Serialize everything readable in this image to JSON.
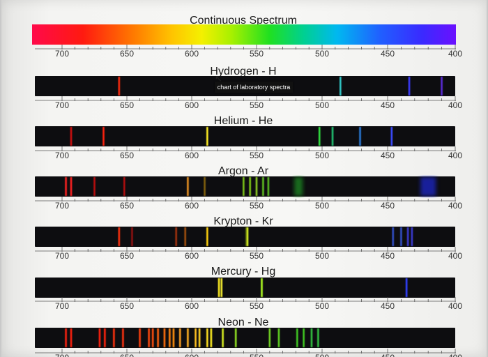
{
  "chart_data": {
    "type": "spectrum",
    "axis": {
      "ticks": [
        700,
        650,
        600,
        550,
        500,
        450,
        400
      ],
      "range": [
        705,
        395
      ]
    },
    "panels": [
      {
        "title": "Continuous Spectrum",
        "kind": "continuous",
        "lines": []
      },
      {
        "title": "Hydrogen - H",
        "kind": "emission",
        "lines": [
          {
            "nm": 656,
            "color": "#ff2a10"
          },
          {
            "nm": 486,
            "color": "#33c8c8"
          },
          {
            "nm": 434,
            "color": "#3a3aff"
          },
          {
            "nm": 410,
            "color": "#5a2ad8"
          }
        ]
      },
      {
        "title": "Helium - He",
        "kind": "emission",
        "lines": [
          {
            "nm": 707,
            "color": "#d01010"
          },
          {
            "nm": 668,
            "color": "#ff2410"
          },
          {
            "nm": 588,
            "color": "#ffee22"
          },
          {
            "nm": 502,
            "color": "#30e040"
          },
          {
            "nm": 492,
            "color": "#20c070"
          },
          {
            "nm": 471,
            "color": "#2a7ad8"
          },
          {
            "nm": 447,
            "color": "#3a4cff"
          }
        ]
      },
      {
        "title": "Argon - Ar",
        "kind": "emission",
        "lines": [
          {
            "nm": 707,
            "color": "#ff2020"
          },
          {
            "nm": 697,
            "color": "#ff2020"
          },
          {
            "nm": 675,
            "color": "#b81010"
          },
          {
            "nm": 652,
            "color": "#b01010"
          },
          {
            "nm": 603,
            "color": "#e89020"
          },
          {
            "nm": 590,
            "color": "#806010"
          },
          {
            "nm": 560,
            "color": "#7ac018"
          },
          {
            "nm": 555,
            "color": "#80c818"
          },
          {
            "nm": 550,
            "color": "#8ac820"
          },
          {
            "nm": 545,
            "color": "#60c020"
          },
          {
            "nm": 541,
            "color": "#58b820"
          },
          {
            "nm": 518,
            "color": "#1a8a20",
            "wide": 12
          },
          {
            "nm": 420,
            "color": "#1a28c8",
            "wide": 22
          }
        ]
      },
      {
        "title": "Krypton - Kr",
        "kind": "emission",
        "lines": [
          {
            "nm": 656,
            "color": "#ff3010"
          },
          {
            "nm": 646,
            "color": "#901010"
          },
          {
            "nm": 612,
            "color": "#a03010"
          },
          {
            "nm": 605,
            "color": "#a05010"
          },
          {
            "nm": 588,
            "color": "#ffd010"
          },
          {
            "nm": 558,
            "color": "#506010"
          },
          {
            "nm": 557,
            "color": "#d8f020"
          },
          {
            "nm": 446,
            "color": "#3050c8"
          },
          {
            "nm": 440,
            "color": "#3050c8"
          },
          {
            "nm": 435,
            "color": "#3a3ad0"
          },
          {
            "nm": 432,
            "color": "#3a3ad0"
          }
        ]
      },
      {
        "title": "Mercury - Hg",
        "kind": "emission",
        "lines": [
          {
            "nm": 579,
            "color": "#ffee20"
          },
          {
            "nm": 577,
            "color": "#f0e830"
          },
          {
            "nm": 546,
            "color": "#b0ff20"
          },
          {
            "nm": 436,
            "color": "#3040ff"
          }
        ]
      },
      {
        "title": "Neon - Ne",
        "kind": "emission",
        "lines": [
          {
            "nm": 703,
            "color": "#ff2010"
          },
          {
            "nm": 693,
            "color": "#ff2010"
          },
          {
            "nm": 671,
            "color": "#ff2410"
          },
          {
            "nm": 667,
            "color": "#ff2410"
          },
          {
            "nm": 660,
            "color": "#ff3010"
          },
          {
            "nm": 653,
            "color": "#ff3010"
          },
          {
            "nm": 640,
            "color": "#ff4010"
          },
          {
            "nm": 633,
            "color": "#ff4a10"
          },
          {
            "nm": 630,
            "color": "#ff5010"
          },
          {
            "nm": 626,
            "color": "#ff6010"
          },
          {
            "nm": 621,
            "color": "#ff7010"
          },
          {
            "nm": 617,
            "color": "#ff8010"
          },
          {
            "nm": 614,
            "color": "#ff9010"
          },
          {
            "nm": 609,
            "color": "#ffa020"
          },
          {
            "nm": 603,
            "color": "#ffb020"
          },
          {
            "nm": 597,
            "color": "#ffc020"
          },
          {
            "nm": 594,
            "color": "#ffd020"
          },
          {
            "nm": 588,
            "color": "#ffe020"
          },
          {
            "nm": 585,
            "color": "#ffee20"
          },
          {
            "nm": 576,
            "color": "#d8f020"
          },
          {
            "nm": 566,
            "color": "#90e020"
          },
          {
            "nm": 540,
            "color": "#70d020"
          },
          {
            "nm": 533,
            "color": "#60d020"
          },
          {
            "nm": 519,
            "color": "#40c820"
          },
          {
            "nm": 514,
            "color": "#40c820"
          },
          {
            "nm": 508,
            "color": "#30c040"
          },
          {
            "nm": 503,
            "color": "#30c040"
          }
        ]
      }
    ]
  },
  "tooltip": {
    "text": "chart of laboratory spectra"
  }
}
